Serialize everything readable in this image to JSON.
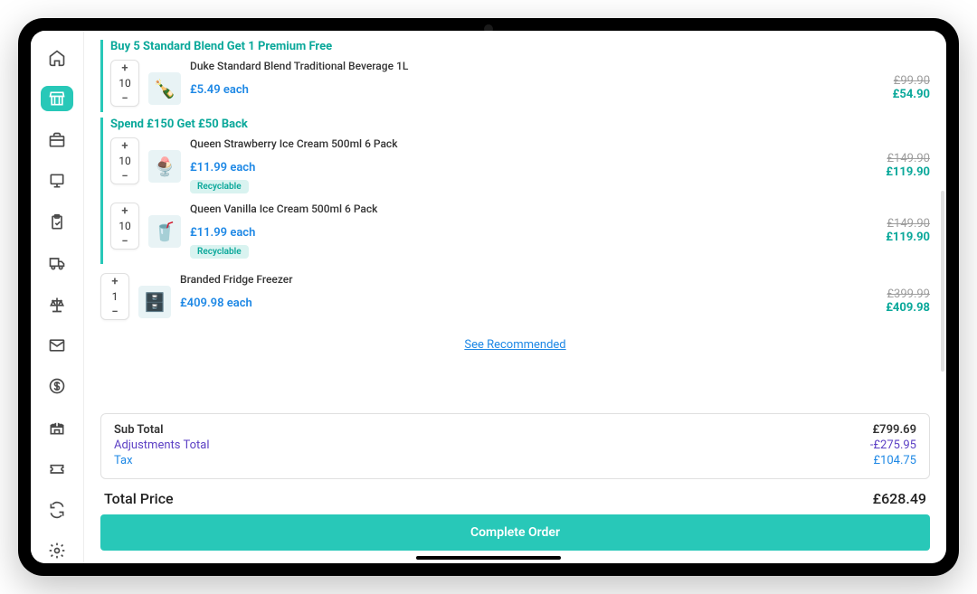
{
  "sidebar": [
    {
      "id": "home",
      "active": false
    },
    {
      "id": "store",
      "active": true
    },
    {
      "id": "briefcase",
      "active": false
    },
    {
      "id": "display",
      "active": false
    },
    {
      "id": "clipboard",
      "active": false
    },
    {
      "id": "truck",
      "active": false
    },
    {
      "id": "scale",
      "active": false
    },
    {
      "id": "mail",
      "active": false
    },
    {
      "id": "dollar",
      "active": false
    },
    {
      "id": "castle",
      "active": false
    },
    {
      "id": "ticket",
      "active": false
    },
    {
      "id": "sync",
      "active": false
    },
    {
      "id": "settings",
      "active": false
    }
  ],
  "promos": [
    {
      "title": "Buy 5 Standard Blend Get 1 Premium Free",
      "items": [
        {
          "name": "Duke Standard Blend Traditional Beverage 1L",
          "qty": 10,
          "unit": "£5.49 each",
          "strike": "£99.90",
          "price": "£54.90",
          "badge": null,
          "emoji": "🍾"
        }
      ]
    },
    {
      "title": "Spend £150 Get £50 Back",
      "items": [
        {
          "name": "Queen Strawberry Ice Cream 500ml 6 Pack",
          "qty": 10,
          "unit": "£11.99 each",
          "strike": "£149.90",
          "price": "£119.90",
          "badge": "Recyclable",
          "emoji": "🍨"
        },
        {
          "name": "Queen Vanilla Ice Cream 500ml 6 Pack",
          "qty": 10,
          "unit": "£11.99 each",
          "strike": "£149.90",
          "price": "£119.90",
          "badge": "Recyclable",
          "emoji": "🥤"
        }
      ]
    }
  ],
  "loose_items": [
    {
      "name": "Branded Fridge Freezer",
      "qty": 1,
      "unit": "£409.98 each",
      "strike": "£399.99",
      "price": "£409.98",
      "badge": null,
      "emoji": "🗄️"
    }
  ],
  "recommend": "See Recommended",
  "summary": {
    "sub_label": "Sub Total",
    "sub_value": "£799.69",
    "adj_label": "Adjustments Total",
    "adj_value": "-£275.95",
    "tax_label": "Tax",
    "tax_value": "£104.75"
  },
  "total": {
    "label": "Total Price",
    "value": "£628.49"
  },
  "complete": "Complete Order"
}
